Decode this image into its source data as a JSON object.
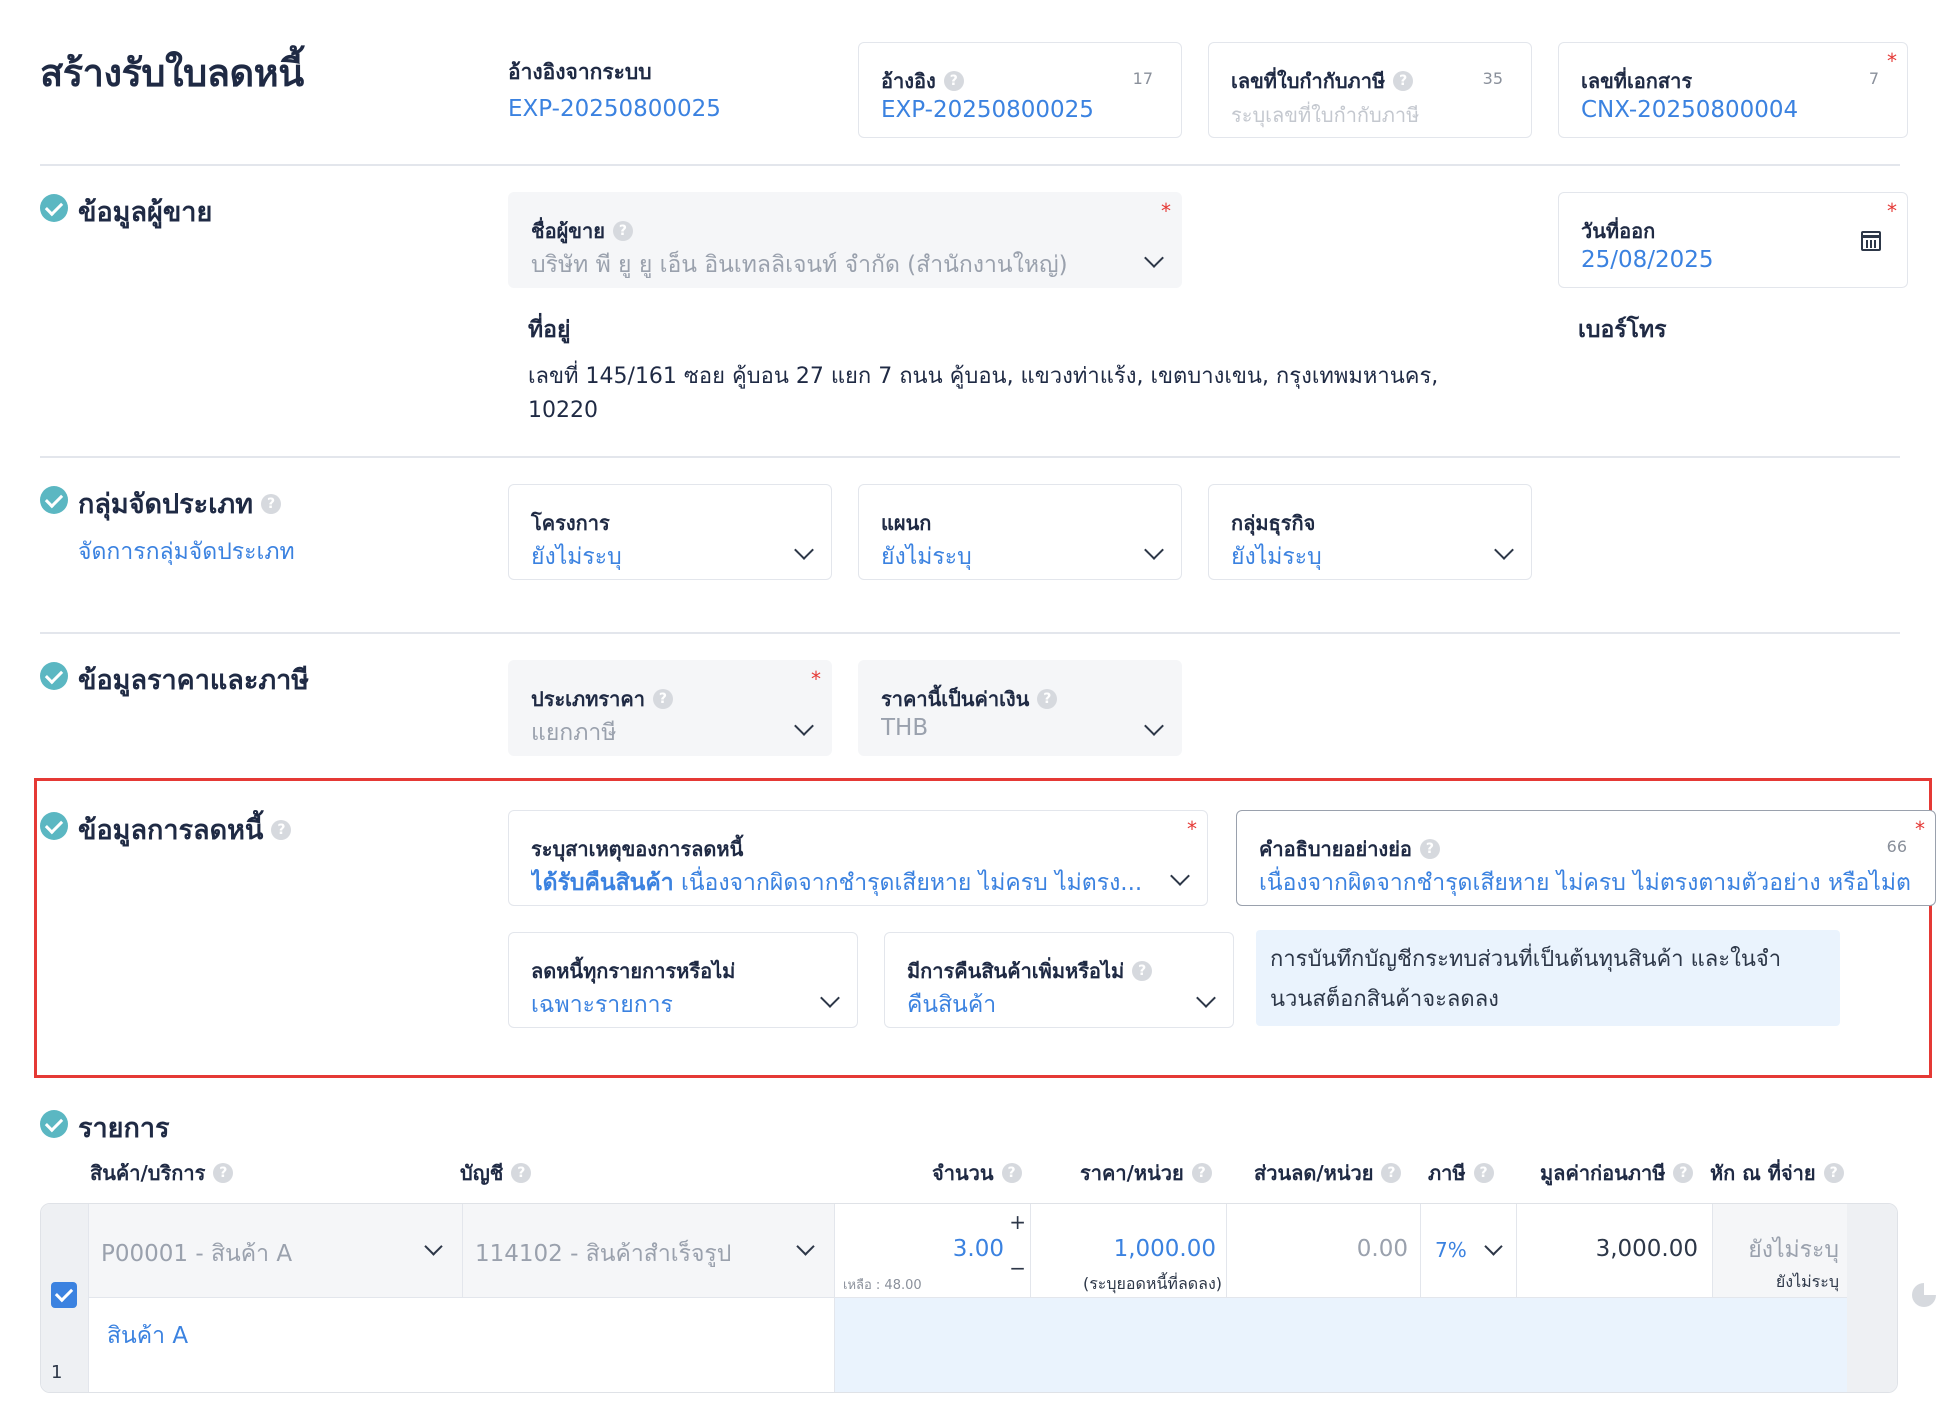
{
  "page": {
    "title": "สร้างรับใบลดหนี้"
  },
  "header": {
    "system_ref": {
      "label": "อ้างอิงจากระบบ",
      "value": "EXP-20250800025"
    },
    "reference": {
      "label": "อ้างอิง",
      "value": "EXP-20250800025",
      "count": "17"
    },
    "tax_invoice_no": {
      "label": "เลขที่ใบกำกับภาษี",
      "placeholder": "ระบุเลขที่ใบกำกับภาษี",
      "count": "35"
    },
    "document_no": {
      "label": "เลขที่เอกสาร",
      "value": "CNX-20250800004",
      "count": "7",
      "required": "*"
    }
  },
  "seller": {
    "section_title": "ข้อมูลผู้ขาย",
    "name_label": "ชื่อผู้ขาย",
    "name_value": "บริษัท พี ยู ยู เอ็น อินเทลลิเจนท์ จำกัด (สำนักงานใหญ่)",
    "required": "*",
    "address_label": "ที่อยู่",
    "address_line1": "เลขที่ 145/161 ซอย คู้บอน 27 แยก 7 ถนน คู้บอน, แขวงท่าแร้ง, เขตบางเขน, กรุงเทพมหานคร,",
    "address_line2": "10220",
    "issue_date_label": "วันที่ออก",
    "issue_date_value": "25/08/2025",
    "phone_label": "เบอร์โทร"
  },
  "classification": {
    "section_title": "กลุ่มจัดประเภท",
    "manage_link": "จัดการกลุ่มจัดประเภท",
    "project_label": "โครงการ",
    "project_value": "ยังไม่ระบุ",
    "department_label": "แผนก",
    "department_value": "ยังไม่ระบุ",
    "business_label": "กลุ่มธุรกิจ",
    "business_value": "ยังไม่ระบุ"
  },
  "pricing": {
    "section_title": "ข้อมูลราคาและภาษี",
    "price_type_label": "ประเภทราคา",
    "price_type_value": "แยกภาษี",
    "currency_label": "ราคานี้เป็นค่าเงิน",
    "currency_value": "THB"
  },
  "credit_note": {
    "section_title": "ข้อมูลการลดหนี้",
    "reason_label": "ระบุสาเหตุของการลดหนี้",
    "reason_bold": "ได้รับคืนสินค้า",
    "reason_value": "เนื่องจากผิดจากชำรุดเสียหาย ไม่ครบ ไม่ตรง...",
    "desc_label": "คำอธิบายอย่างย่อ",
    "desc_count": "66",
    "desc_value": "เนื่องจากผิดจากชำรุดเสียหาย ไม่ครบ ไม่ตรงตามตัวอย่าง หรือไม่ต",
    "all_items_label": "ลดหนี้ทุกรายการหรือไม่",
    "all_items_value": "เฉพาะรายการ",
    "return_label": "มีการคืนสินค้าเพิ่มหรือไม่",
    "return_value": "คืนสินค้า",
    "note_line1": "การบันทึกบัญชีกระทบส่วนที่เป็นต้นทุนสินค้า และในจำ",
    "note_line2": "นวนสต็อกสินค้าจะลดลง"
  },
  "items": {
    "section_title": "รายการ",
    "columns": {
      "product": "สินค้า/บริการ",
      "account": "บัญชี",
      "qty": "จำนวน",
      "unit_price": "ราคา/หน่วย",
      "discount": "ส่วนลด/หน่วย",
      "tax": "ภาษี",
      "pretax": "มูลค่าก่อนภาษี",
      "wht": "หัก ณ ที่จ่าย"
    },
    "rows": [
      {
        "index": "1",
        "product": "P00001 - สินค้า A",
        "account": "114102 - สินค้าสำเร็จรูป",
        "qty": "3.00",
        "remaining": "เหลือ : 48.00",
        "unit_price": "1,000.00",
        "unit_price_note": "(ระบุยอดหนี้ที่ลดลง)",
        "discount": "0.00",
        "tax": "7%",
        "pretax": "3,000.00",
        "wht": "ยังไม่ระบุ",
        "wht_sub": "ยังไม่ระบุ",
        "description": "สินค้า A"
      }
    ]
  },
  "colors": {
    "accent": "#3b82e0",
    "check": "#5bb7c2",
    "required": "#e53935",
    "highlight": "#e53935"
  }
}
